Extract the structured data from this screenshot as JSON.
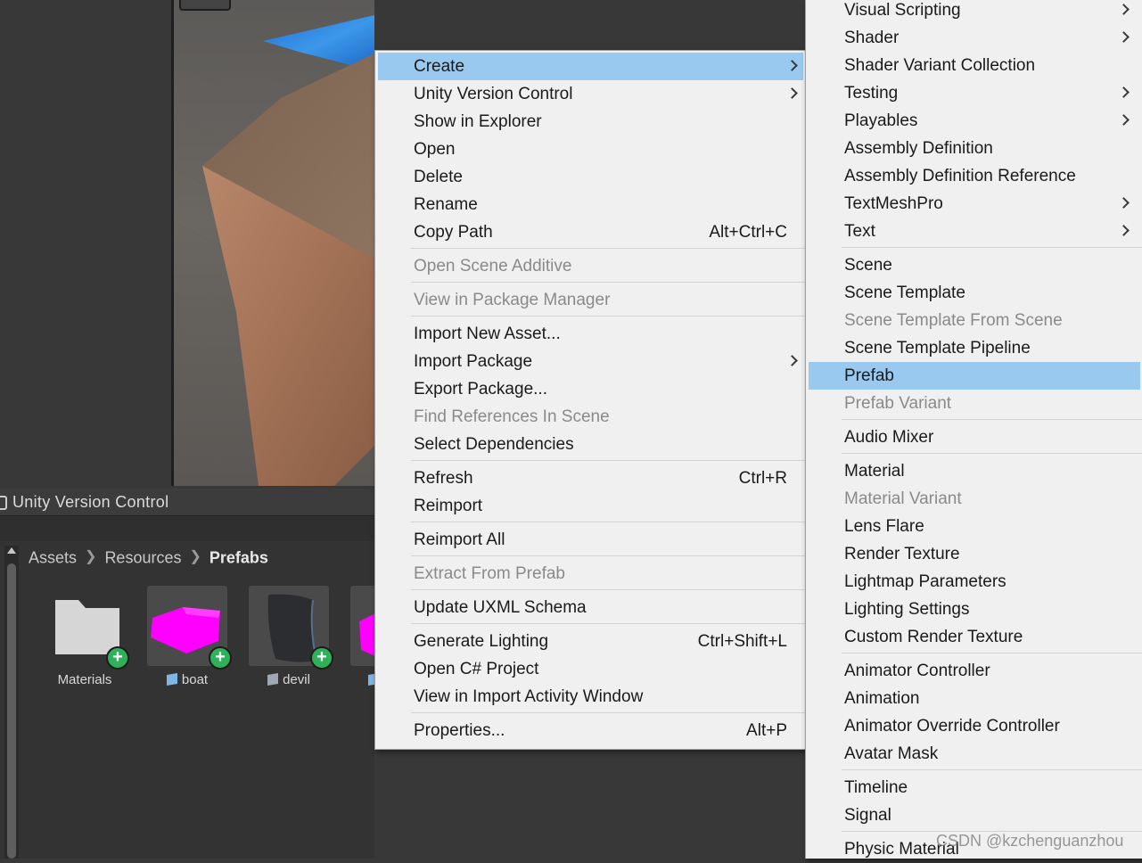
{
  "project_window": {
    "uvc_tab_title": "Unity Version Control",
    "breadcrumb": [
      "Assets",
      "Resources",
      "Prefabs"
    ],
    "assets": [
      {
        "name": "Materials",
        "kind": "folder"
      },
      {
        "name": "boat",
        "kind": "prefab"
      },
      {
        "name": "devil",
        "kind": "prefab"
      },
      {
        "name": "",
        "kind": "prefab"
      }
    ]
  },
  "context_menu": {
    "items": [
      {
        "label": "Create",
        "shortcut": "",
        "submenu": true,
        "disabled": false,
        "highlighted": true
      },
      {
        "label": "Unity Version Control",
        "shortcut": "",
        "submenu": true,
        "disabled": false
      },
      {
        "label": "Show in Explorer",
        "shortcut": "",
        "submenu": false,
        "disabled": false
      },
      {
        "label": "Open",
        "shortcut": "",
        "submenu": false,
        "disabled": false
      },
      {
        "label": "Delete",
        "shortcut": "",
        "submenu": false,
        "disabled": false
      },
      {
        "label": "Rename",
        "shortcut": "",
        "submenu": false,
        "disabled": false
      },
      {
        "label": "Copy Path",
        "shortcut": "Alt+Ctrl+C",
        "submenu": false,
        "disabled": false,
        "separator_after": true
      },
      {
        "label": "Open Scene Additive",
        "shortcut": "",
        "submenu": false,
        "disabled": true,
        "separator_after": true
      },
      {
        "label": "View in Package Manager",
        "shortcut": "",
        "submenu": false,
        "disabled": true,
        "separator_after": true
      },
      {
        "label": "Import New Asset...",
        "shortcut": "",
        "submenu": false,
        "disabled": false
      },
      {
        "label": "Import Package",
        "shortcut": "",
        "submenu": true,
        "disabled": false
      },
      {
        "label": "Export Package...",
        "shortcut": "",
        "submenu": false,
        "disabled": false
      },
      {
        "label": "Find References In Scene",
        "shortcut": "",
        "submenu": false,
        "disabled": true
      },
      {
        "label": "Select Dependencies",
        "shortcut": "",
        "submenu": false,
        "disabled": false,
        "separator_after": true
      },
      {
        "label": "Refresh",
        "shortcut": "Ctrl+R",
        "submenu": false,
        "disabled": false
      },
      {
        "label": "Reimport",
        "shortcut": "",
        "submenu": false,
        "disabled": false,
        "separator_after": true
      },
      {
        "label": "Reimport All",
        "shortcut": "",
        "submenu": false,
        "disabled": false,
        "separator_after": true
      },
      {
        "label": "Extract From Prefab",
        "shortcut": "",
        "submenu": false,
        "disabled": true,
        "separator_after": true
      },
      {
        "label": "Update UXML Schema",
        "shortcut": "",
        "submenu": false,
        "disabled": false,
        "separator_after": true
      },
      {
        "label": "Generate Lighting",
        "shortcut": "Ctrl+Shift+L",
        "submenu": false,
        "disabled": false
      },
      {
        "label": "Open C# Project",
        "shortcut": "",
        "submenu": false,
        "disabled": false
      },
      {
        "label": "View in Import Activity Window",
        "shortcut": "",
        "submenu": false,
        "disabled": false,
        "separator_after": true
      },
      {
        "label": "Properties...",
        "shortcut": "Alt+P",
        "submenu": false,
        "disabled": false
      }
    ]
  },
  "create_submenu": {
    "items": [
      {
        "label": "Visual Scripting",
        "submenu": true,
        "disabled": false
      },
      {
        "label": "Shader",
        "submenu": true,
        "disabled": false
      },
      {
        "label": "Shader Variant Collection",
        "submenu": false,
        "disabled": false
      },
      {
        "label": "Testing",
        "submenu": true,
        "disabled": false
      },
      {
        "label": "Playables",
        "submenu": true,
        "disabled": false
      },
      {
        "label": "Assembly Definition",
        "submenu": false,
        "disabled": false
      },
      {
        "label": "Assembly Definition Reference",
        "submenu": false,
        "disabled": false
      },
      {
        "label": "TextMeshPro",
        "submenu": true,
        "disabled": false
      },
      {
        "label": "Text",
        "submenu": true,
        "disabled": false,
        "separator_after": true
      },
      {
        "label": "Scene",
        "submenu": false,
        "disabled": false
      },
      {
        "label": "Scene Template",
        "submenu": false,
        "disabled": false
      },
      {
        "label": "Scene Template From Scene",
        "submenu": false,
        "disabled": true
      },
      {
        "label": "Scene Template Pipeline",
        "submenu": false,
        "disabled": false
      },
      {
        "label": "Prefab",
        "submenu": false,
        "disabled": false,
        "highlighted": true
      },
      {
        "label": "Prefab Variant",
        "submenu": false,
        "disabled": true,
        "separator_after": true
      },
      {
        "label": "Audio Mixer",
        "submenu": false,
        "disabled": false,
        "separator_after": true
      },
      {
        "label": "Material",
        "submenu": false,
        "disabled": false
      },
      {
        "label": "Material Variant",
        "submenu": false,
        "disabled": true
      },
      {
        "label": "Lens Flare",
        "submenu": false,
        "disabled": false
      },
      {
        "label": "Render Texture",
        "submenu": false,
        "disabled": false
      },
      {
        "label": "Lightmap Parameters",
        "submenu": false,
        "disabled": false
      },
      {
        "label": "Lighting Settings",
        "submenu": false,
        "disabled": false
      },
      {
        "label": "Custom Render Texture",
        "submenu": false,
        "disabled": false,
        "separator_after": true
      },
      {
        "label": "Animator Controller",
        "submenu": false,
        "disabled": false
      },
      {
        "label": "Animation",
        "submenu": false,
        "disabled": false
      },
      {
        "label": "Animator Override Controller",
        "submenu": false,
        "disabled": false
      },
      {
        "label": "Avatar Mask",
        "submenu": false,
        "disabled": false,
        "separator_after": true
      },
      {
        "label": "Timeline",
        "submenu": false,
        "disabled": false
      },
      {
        "label": "Signal",
        "submenu": false,
        "disabled": false,
        "separator_after": true
      },
      {
        "label": "Physic Material",
        "submenu": false,
        "disabled": false
      }
    ]
  },
  "watermark": "CSDN @kzchenguanzhou",
  "colors": {
    "menu_background": "#f0f0f0",
    "highlight": "#99c9ef",
    "disabled_text": "#8a8a8a",
    "editor_dark": "#383838",
    "prefab_magenta": "#ff00ff",
    "add_badge_green": "#2fb15a"
  }
}
